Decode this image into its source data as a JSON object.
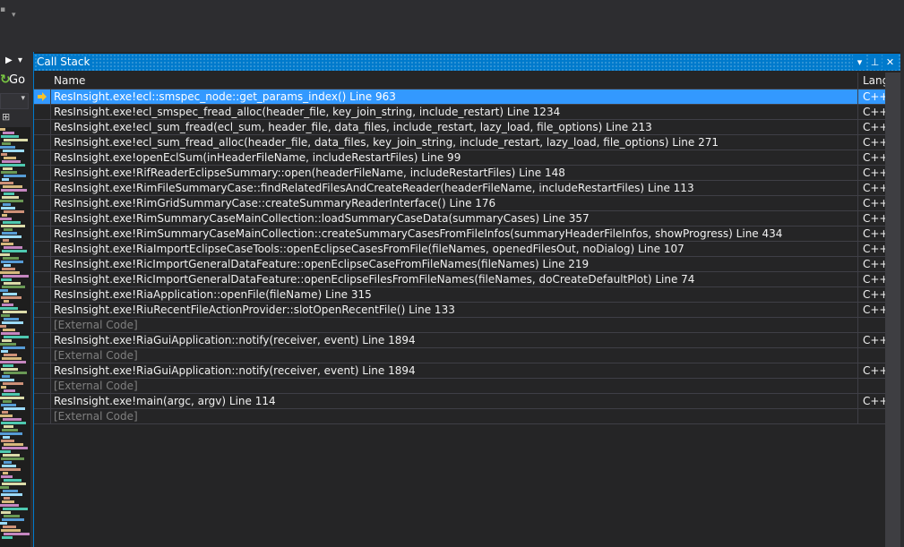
{
  "toolbar": {
    "go_label": "Go"
  },
  "panel": {
    "title": "Call Stack",
    "columns": {
      "name": "Name",
      "lang": "Lang"
    },
    "rows": [
      {
        "name": "ResInsight.exe!ecl::smspec_node::get_params_index() Line 963",
        "lang": "C++",
        "active": true
      },
      {
        "name": "ResInsight.exe!ecl_smspec_fread_alloc(header_file, key_join_string, include_restart) Line 1234",
        "lang": "C++"
      },
      {
        "name": "ResInsight.exe!ecl_sum_fread(ecl_sum, header_file, data_files, include_restart, lazy_load, file_options) Line 213",
        "lang": "C++"
      },
      {
        "name": "ResInsight.exe!ecl_sum_fread_alloc(header_file, data_files, key_join_string, include_restart, lazy_load, file_options) Line 271",
        "lang": "C++"
      },
      {
        "name": "ResInsight.exe!openEclSum(inHeaderFileName, includeRestartFiles) Line 99",
        "lang": "C++"
      },
      {
        "name": "ResInsight.exe!RifReaderEclipseSummary::open(headerFileName, includeRestartFiles) Line 148",
        "lang": "C++"
      },
      {
        "name": "ResInsight.exe!RimFileSummaryCase::findRelatedFilesAndCreateReader(headerFileName, includeRestartFiles) Line 113",
        "lang": "C++"
      },
      {
        "name": "ResInsight.exe!RimGridSummaryCase::createSummaryReaderInterface() Line 176",
        "lang": "C++"
      },
      {
        "name": "ResInsight.exe!RimSummaryCaseMainCollection::loadSummaryCaseData(summaryCases) Line 357",
        "lang": "C++"
      },
      {
        "name": "ResInsight.exe!RimSummaryCaseMainCollection::createSummaryCasesFromFileInfos(summaryHeaderFileInfos, showProgress) Line 434",
        "lang": "C++"
      },
      {
        "name": "ResInsight.exe!RiaImportEclipseCaseTools::openEclipseCasesFromFile(fileNames, openedFilesOut, noDialog) Line 107",
        "lang": "C++"
      },
      {
        "name": "ResInsight.exe!RicImportGeneralDataFeature::openEclipseCaseFromFileNames(fileNames) Line 219",
        "lang": "C++"
      },
      {
        "name": "ResInsight.exe!RicImportGeneralDataFeature::openEclipseFilesFromFileNames(fileNames, doCreateDefaultPlot) Line 74",
        "lang": "C++"
      },
      {
        "name": "ResInsight.exe!RiaApplication::openFile(fileName) Line 315",
        "lang": "C++"
      },
      {
        "name": "ResInsight.exe!RiuRecentFileActionProvider::slotOpenRecentFile() Line 133",
        "lang": "C++"
      },
      {
        "name": "[External Code]",
        "lang": "",
        "external": true
      },
      {
        "name": "ResInsight.exe!RiaGuiApplication::notify(receiver, event) Line 1894",
        "lang": "C++"
      },
      {
        "name": "[External Code]",
        "lang": "",
        "external": true
      },
      {
        "name": "ResInsight.exe!RiaGuiApplication::notify(receiver, event) Line 1894",
        "lang": "C++"
      },
      {
        "name": "[External Code]",
        "lang": "",
        "external": true
      },
      {
        "name": "ResInsight.exe!main(argc, argv) Line 114",
        "lang": "C++"
      },
      {
        "name": "[External Code]",
        "lang": "",
        "external": true
      }
    ]
  },
  "colors": {
    "accent": "#007acc",
    "selection": "#3399ff",
    "background": "#252526",
    "external_text": "#808080",
    "current_frame_arrow": "#f5c22b"
  }
}
